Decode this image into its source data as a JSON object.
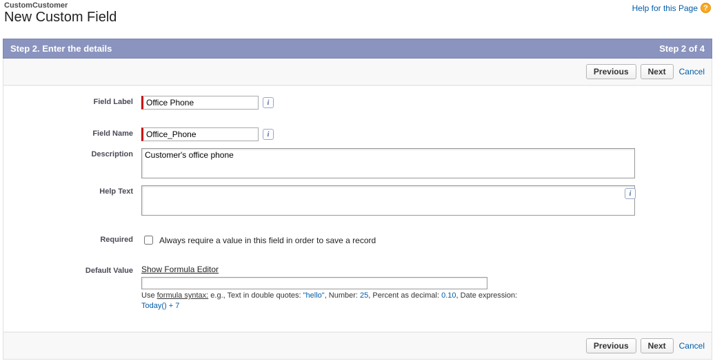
{
  "header": {
    "context": "CustomCustomer",
    "title": "New Custom Field",
    "helpLink": "Help for this Page",
    "helpGlyph": "?"
  },
  "stepBar": {
    "left": "Step 2. Enter the details",
    "right": "Step 2 of 4"
  },
  "buttons": {
    "previous": "Previous",
    "next": "Next",
    "cancel": "Cancel"
  },
  "form": {
    "fieldLabel": {
      "label": "Field Label",
      "value": "Office Phone"
    },
    "fieldName": {
      "label": "Field Name",
      "value": "Office_Phone"
    },
    "description": {
      "label": "Description",
      "value": "Customer's office phone "
    },
    "helpText": {
      "label": "Help Text",
      "value": ""
    },
    "required": {
      "label": "Required",
      "text": "Always require a value in this field in order to save a record",
      "checked": false
    },
    "defaultValue": {
      "label": "Default Value",
      "formulaLink": "Show Formula Editor",
      "value": "",
      "hintPrefix": "Use ",
      "hintUnderline": "formula syntax:",
      "hintText": " e.g., Text in double quotes: ",
      "hintQuote": "\"hello\"",
      "hintNumber": ", Number: ",
      "hintNumberVal": "25",
      "hintPercent": ", Percent as decimal: ",
      "hintPercentVal": "0.10",
      "hintDate": ", Date expression: ",
      "hintDateVal": "Today() + 7"
    }
  },
  "infoGlyph": "i"
}
